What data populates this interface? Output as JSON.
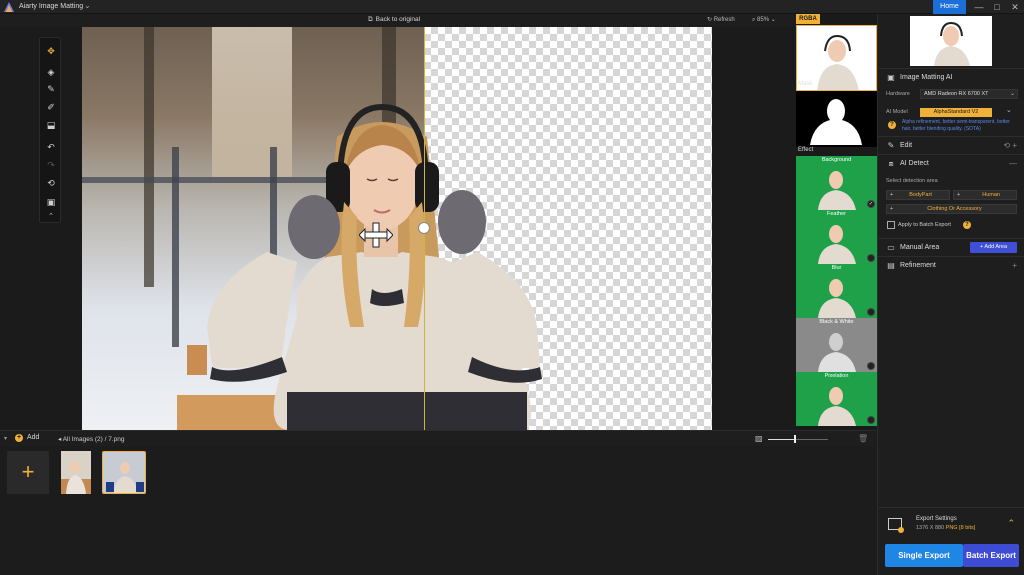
{
  "app": {
    "title": "Aiarty Image Matting"
  },
  "window": {
    "home_label": "Home",
    "minimize": "—",
    "maximize": "□",
    "close": "✕"
  },
  "topbar": {
    "back_label": "Back to original",
    "refresh_label": "Refresh",
    "zoom_value": "85%"
  },
  "toolbox": {
    "tools": [
      "move-tool",
      "eraser-tool",
      "brush-tool",
      "restore-brush-tool",
      "fill-tool",
      "undo",
      "redo",
      "reset",
      "compare-tool",
      "collapse"
    ]
  },
  "effects": {
    "rgba_label": "RGBA",
    "mask_label": "Mask",
    "effect_label": "Effect",
    "items": [
      {
        "name": "Background",
        "selected": true
      },
      {
        "name": "Feather",
        "selected": false
      },
      {
        "name": "Blur",
        "selected": false
      },
      {
        "name": "Black & White",
        "selected": false
      },
      {
        "name": "Pixelation",
        "selected": false
      }
    ]
  },
  "panel": {
    "matting": {
      "title": "Image Matting AI",
      "hardware_label": "Hardware",
      "hardware_value": "AMD Radeon RX 6700 XT",
      "model_label": "AI Model",
      "model_value": "AlphaStandard  V2",
      "hint": "Alpha refinement, better semi-transparent, better hair, better blending quality. (SOTA)"
    },
    "edit": {
      "title": "Edit"
    },
    "detect": {
      "title": "AI Detect",
      "subtitle": "Select detection area",
      "chips": [
        "BodyPart",
        "Human",
        "Clothing Or Accessory"
      ],
      "batch_label": "Apply to Batch Export"
    },
    "manual": {
      "title": "Manual Area",
      "add_label": "+ Add Area"
    },
    "refine": {
      "title": "Refinement"
    },
    "export": {
      "title": "Export Settings",
      "size": "1376 X 880",
      "format": "PNG",
      "bits": "[8 bits]",
      "single_label": "Single Export",
      "batch_label": "Batch Export"
    }
  },
  "strip": {
    "add_label": "Add",
    "all_images": "All Images (2)",
    "separator": "/",
    "file_name": "7.png",
    "zoom_fraction": 0.45
  },
  "colors": {
    "accent": "#f0b13a",
    "blue": "#1f86e6",
    "indigo": "#3e4bd4",
    "green": "#1fa14a"
  }
}
